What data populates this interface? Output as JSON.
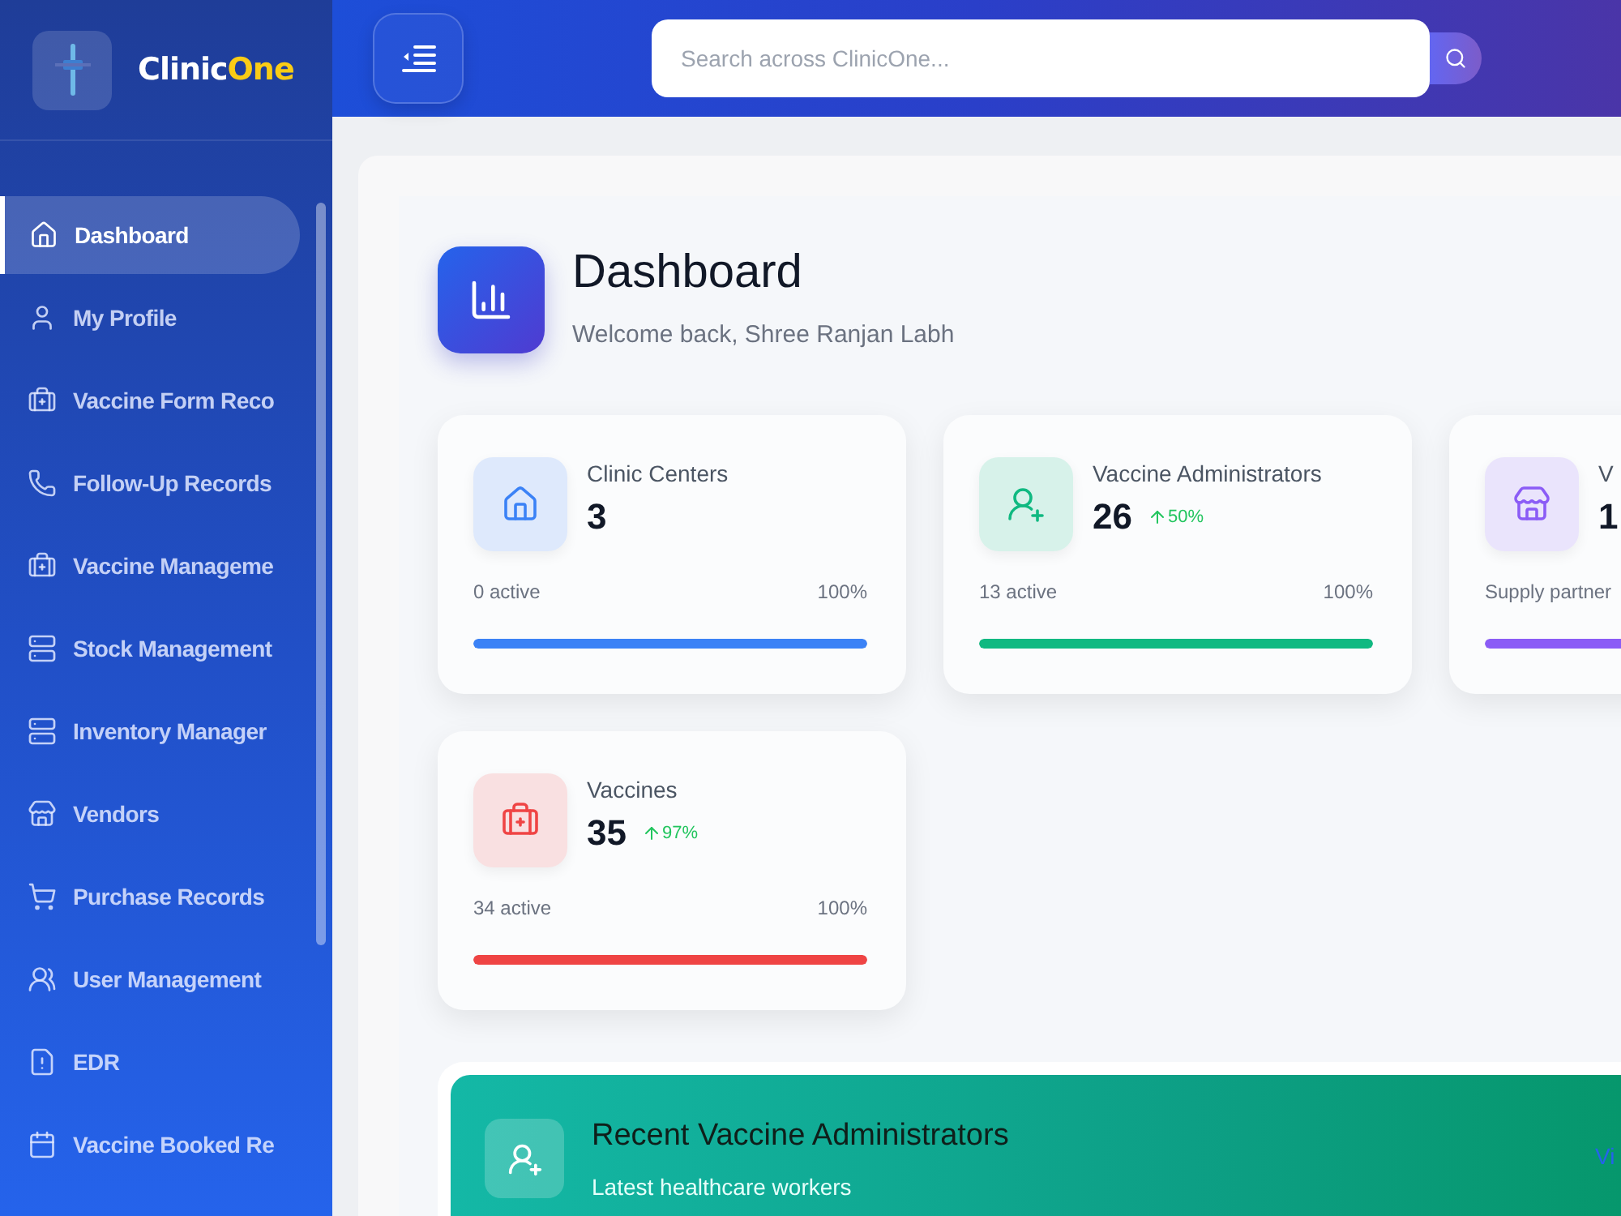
{
  "brand": {
    "name_part1": "Clinic",
    "name_part2": "One"
  },
  "sidebar": {
    "items": [
      {
        "label": "Dashboard",
        "kind": "home",
        "selected": true
      },
      {
        "label": "My Profile",
        "kind": "user",
        "selected": false
      },
      {
        "label": "Vaccine Form Reco",
        "kind": "kit",
        "selected": false
      },
      {
        "label": "Follow-Up Records",
        "kind": "phone",
        "selected": false
      },
      {
        "label": "Vaccine Manageme",
        "kind": "kit",
        "selected": false
      },
      {
        "label": "Stock Management",
        "kind": "server",
        "selected": false
      },
      {
        "label": "Inventory Manager",
        "kind": "server",
        "selected": false
      },
      {
        "label": "Vendors",
        "kind": "store",
        "selected": false
      },
      {
        "label": "Purchase Records",
        "kind": "cart",
        "selected": false
      },
      {
        "label": "User Management",
        "kind": "users",
        "selected": false
      },
      {
        "label": "EDR",
        "kind": "file",
        "selected": false
      },
      {
        "label": "Vaccine Booked Re",
        "kind": "calendar",
        "selected": false
      }
    ]
  },
  "search": {
    "placeholder": "Search across ClinicOne..."
  },
  "header": {
    "title": "Dashboard",
    "subtitle": "Welcome back, Shree Ranjan Labh"
  },
  "cards": [
    {
      "title": "Clinic Centers",
      "value": "3",
      "active": "0 active",
      "percent": "100%",
      "kind": "home",
      "color": "#3b82f6",
      "level": 1
    },
    {
      "title": "Vaccine Administrators",
      "value": "26",
      "trend": "50%",
      "active": "13 active",
      "percent": "100%",
      "kind": "userplus",
      "color": "#10b981",
      "level": 1
    },
    {
      "title": "V",
      "value": "1",
      "active": "Supply partner",
      "kind": "store",
      "color": "#8b5cf6",
      "level": 1
    },
    {
      "title": "Vaccines",
      "value": "35",
      "trend": "97%",
      "active": "34 active",
      "percent": "100%",
      "kind": "kit",
      "color": "#ef4444",
      "level": 1
    }
  ],
  "recent": {
    "title": "Recent Vaccine Administrators",
    "subtitle": "Latest healthcare workers",
    "link": "Vi"
  }
}
